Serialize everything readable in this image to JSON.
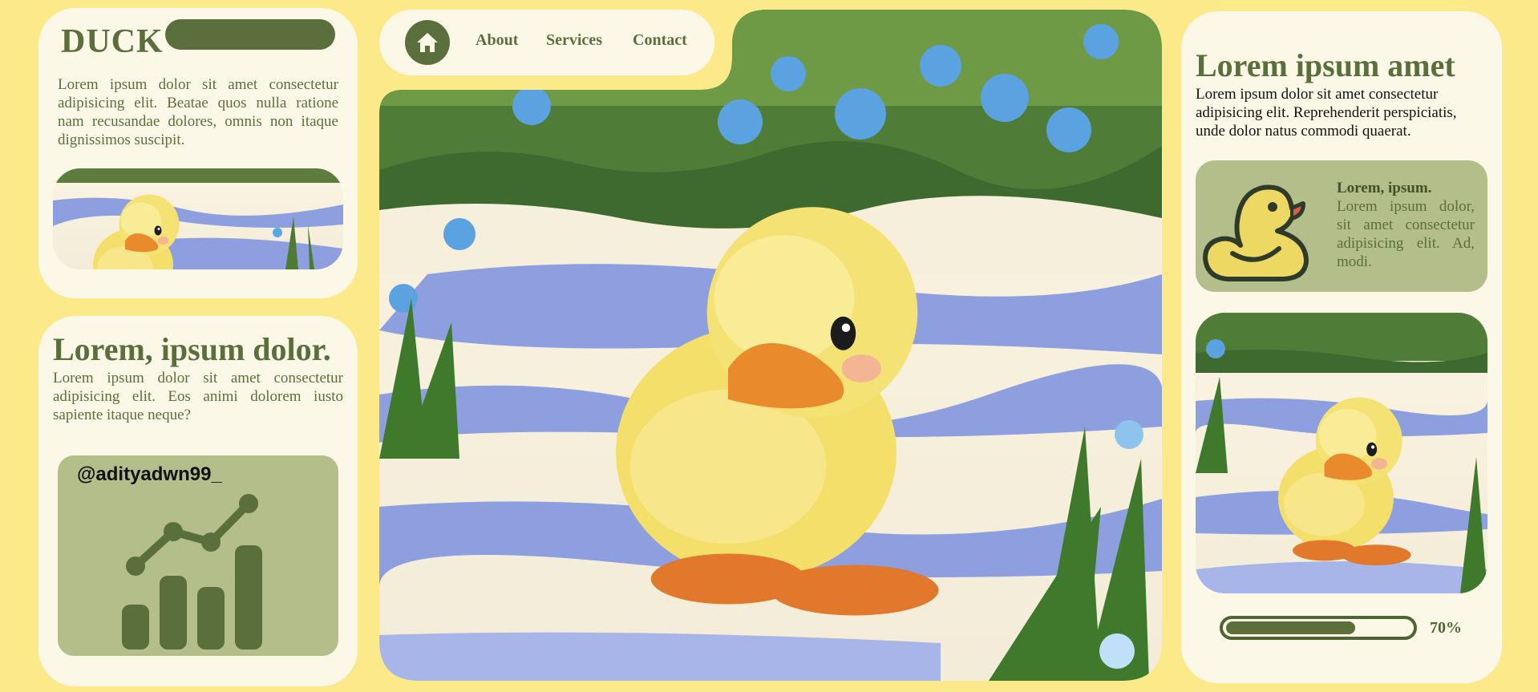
{
  "brand": {
    "title": "DUCK",
    "text": "Lorem ipsum dolor sit amet consectetur adipisicing elit. Beatae quos nulla ratione nam recusandae dolores, omnis non itaque dignissimos suscipit."
  },
  "stats": {
    "title": "Lorem, ipsum dolor.",
    "text": "Lorem ipsum dolor sit amet consectetur adipisicing elit. Eos animi dolorem iusto sapiente itaque neque?",
    "handle": "@adityadwn99_",
    "icon": "growth-chart-icon"
  },
  "nav": {
    "home_icon": "home-icon",
    "links": [
      "About",
      "Services",
      "Contact"
    ]
  },
  "right": {
    "title": "Lorem ipsum amet",
    "text": "Lorem ipsum dolor sit amet consectetur adipisicing elit. Reprehenderit perspiciatis, unde dolor natus commodi quaerat.",
    "feature": {
      "icon": "rubber-duck-icon",
      "heading": "Lorem, ipsum.",
      "text": "Lorem ipsum dolor, sit amet consectetur adipisicing elit. Ad, modi."
    },
    "progress": {
      "value": 0.7,
      "label": "70%"
    }
  },
  "colors": {
    "background": "#fce98a",
    "card": "#fcf8e8",
    "accent": "#5b6f3c",
    "panel": "#b3be8a"
  }
}
